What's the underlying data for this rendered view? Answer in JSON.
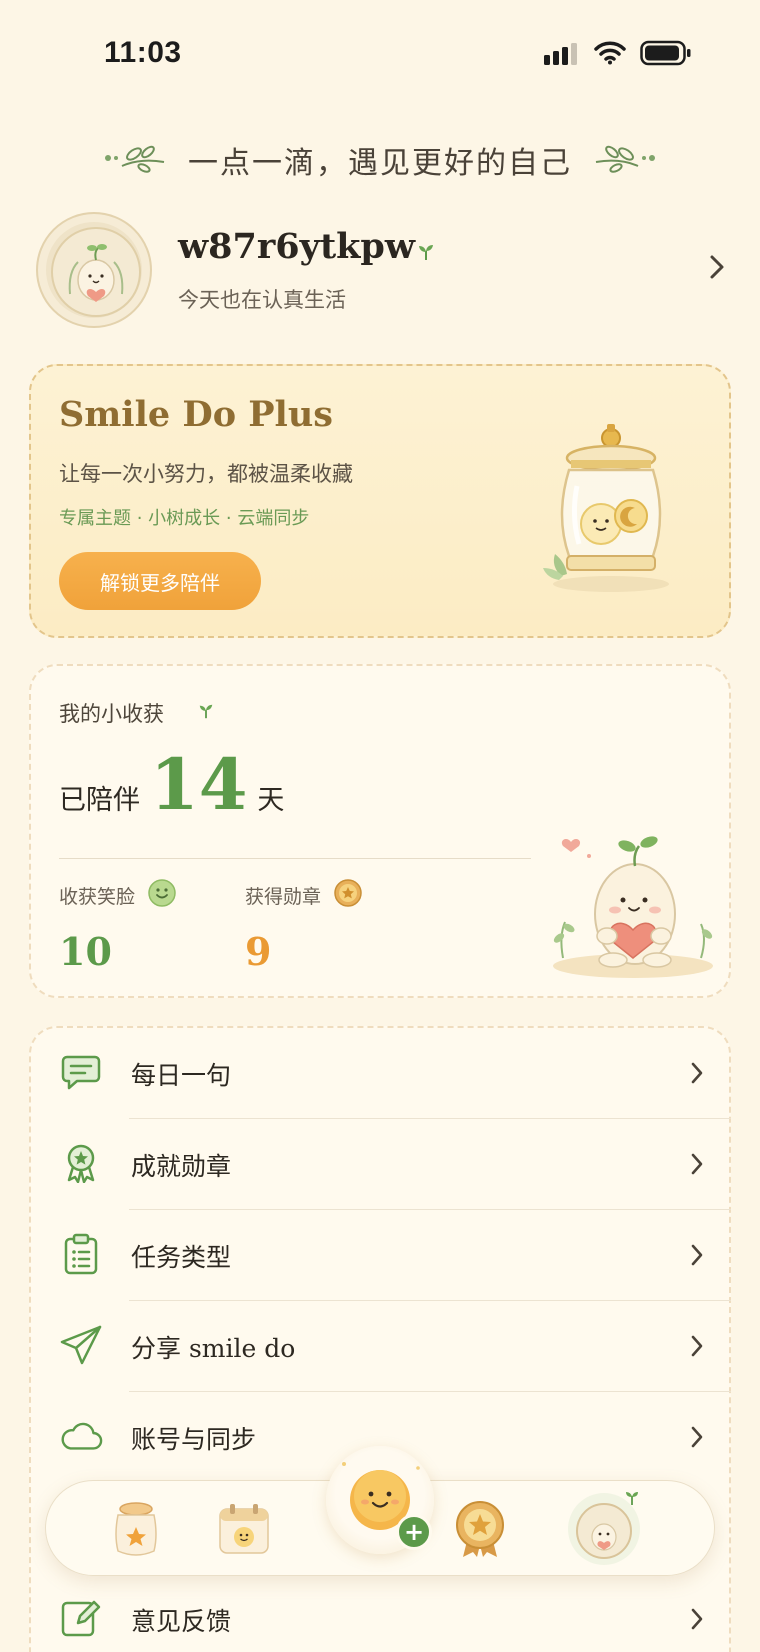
{
  "status_bar": {
    "time": "11:03"
  },
  "slogan": "一点一滴，遇见更好的自己",
  "profile": {
    "username": "w87r6ytkpw",
    "tagline": "今天也在认真生活"
  },
  "plus_card": {
    "title": "Smile Do Plus",
    "subtitle": "让每一次小努力，都被温柔收藏",
    "features": "专属主题 · 小树成长 · 云端同步",
    "button_label": "解锁更多陪伴"
  },
  "harvest": {
    "title": "我的小收获",
    "days_prefix": "已陪伴",
    "days_value": "14",
    "days_suffix": "天",
    "smiles_label": "收获笑脸",
    "smiles_value": "10",
    "badges_label": "获得勋章",
    "badges_value": "9"
  },
  "menu": [
    {
      "label": "每日一句",
      "icon": "chat-bubble-icon"
    },
    {
      "label": "成就勋章",
      "icon": "award-ribbon-icon"
    },
    {
      "label": "任务类型",
      "icon": "clipboard-list-icon"
    },
    {
      "label": "分享 smile do",
      "icon": "paper-plane-icon"
    },
    {
      "label": "账号与同步",
      "icon": "cloud-icon"
    },
    {
      "label": "意见反馈",
      "icon": "edit-icon"
    }
  ],
  "tabbar": {
    "tabs": [
      "jar-tab-icon",
      "calendar-tab-icon",
      "add-task-fab-icon",
      "medal-tab-icon",
      "profile-tab-icon"
    ],
    "active": "profile-tab-icon"
  },
  "colors": {
    "accent_green": "#5c9a4a",
    "accent_orange": "#f0a23a",
    "gold": "#8f6d32",
    "background": "#fdf6e6"
  }
}
